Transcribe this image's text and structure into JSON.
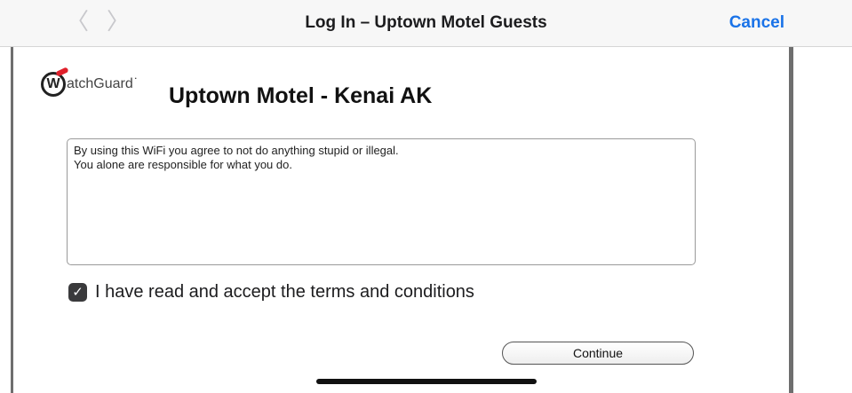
{
  "navbar": {
    "back_icon": "chevron-left-icon",
    "forward_icon": "chevron-right-icon",
    "title": "Log In – Uptown Motel Guests",
    "cancel_label": "Cancel"
  },
  "logo": {
    "badge_letter": "W",
    "text": "atchGuard",
    "mark": "˙",
    "accent_color": "#e0202b"
  },
  "page": {
    "heading": "Uptown Motel - Kenai AK",
    "terms_text": "By using this WiFi you agree to not do anything stupid or illegal.\nYou alone are responsible for what you do.",
    "accept_checked": true,
    "accept_label": "I have read and accept the terms and conditions",
    "continue_label": "Continue"
  },
  "colors": {
    "link_blue": "#1a73e8",
    "frame_gray": "#6e6e6e"
  }
}
